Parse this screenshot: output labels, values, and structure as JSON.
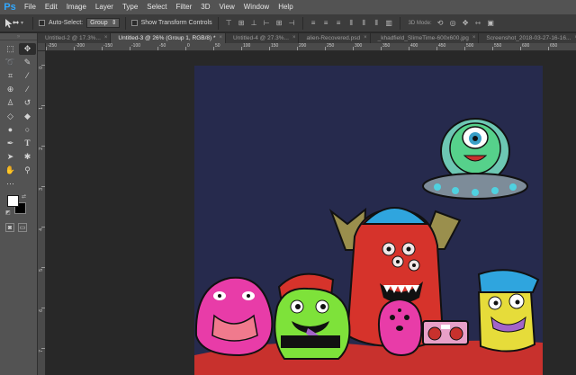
{
  "menubar": {
    "logo": "Ps",
    "items": [
      "File",
      "Edit",
      "Image",
      "Layer",
      "Type",
      "Select",
      "Filter",
      "3D",
      "View",
      "Window",
      "Help"
    ]
  },
  "options": {
    "auto_select_label": "Auto-Select:",
    "auto_select_value": "Group",
    "transform_label": "Show Transform Controls",
    "mode_label": "3D Mode:"
  },
  "tabs": [
    {
      "label": "Untitled-2 @ 17.3%...",
      "active": false
    },
    {
      "label": "Untitled-3 @ 26% (Group 1, RGB/8) *",
      "active": true
    },
    {
      "label": "Untitled-4 @ 27.3%...",
      "active": false
    },
    {
      "label": "alien-Recovered.psd",
      "active": false
    },
    {
      "label": "_khadfield_SlimeTime-600x600.jpg",
      "active": false
    },
    {
      "label": "Screenshot_2018-03-27-16-16...",
      "active": false
    }
  ],
  "ruler": {
    "top": [
      "-250",
      "-200",
      "-150",
      "-100",
      "-50",
      "0",
      "50",
      "100",
      "150",
      "200",
      "250",
      "300",
      "350",
      "400",
      "450",
      "500",
      "550",
      "600",
      "650"
    ],
    "left": [
      "0",
      "1",
      "2",
      "3",
      "4",
      "5",
      "6",
      "7"
    ]
  },
  "colors": {
    "canvas_bg": "#262a4d",
    "accent": "#31a8ff"
  }
}
